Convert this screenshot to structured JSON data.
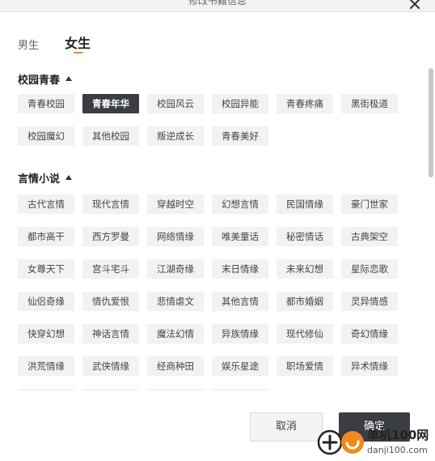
{
  "window": {
    "title": "修改书籍信息"
  },
  "tabs": {
    "male": "男生",
    "female": "女生"
  },
  "sections": [
    {
      "title": "校园青春",
      "tags": [
        "青春校园",
        "青春年华",
        "校园风云",
        "校园异能",
        "青春疼痛",
        "黑街极道",
        "校园魔幻",
        "其他校园",
        "叛逆成长",
        "青春美好"
      ],
      "selected": "青春年华"
    },
    {
      "title": "言情小说",
      "tags": [
        "古代言情",
        "现代言情",
        "穿越时空",
        "幻想言情",
        "民国情缘",
        "豪门世家",
        "都市高干",
        "西方罗曼",
        "网络情缘",
        "唯美童话",
        "秘密情话",
        "古典架空",
        "女尊天下",
        "宫斗宅斗",
        "江湖奇缘",
        "末日情缘",
        "未来幻想",
        "星际恋歌",
        "仙侣奇缘",
        "情仇爱恨",
        "悲情虐文",
        "其他言情",
        "都市婚姻",
        "灵异情感",
        "快穿幻想",
        "神话言情",
        "魔法幻情",
        "异族情缘",
        "现代修仙",
        "奇幻情缘",
        "洪荒情缘",
        "武侠情缘",
        "经商种田",
        "娱乐星途",
        "职场爱情",
        "异术情缘"
      ]
    }
  ],
  "buttons": {
    "cancel": "取消",
    "ok": "确定"
  },
  "watermark": {
    "text_cn": "单机100网",
    "text_url": "danji100.com"
  },
  "colors": {
    "accent": "#f08a1a",
    "selected_bg": "#3a3d42",
    "tag_bg": "#f2f2f2"
  }
}
